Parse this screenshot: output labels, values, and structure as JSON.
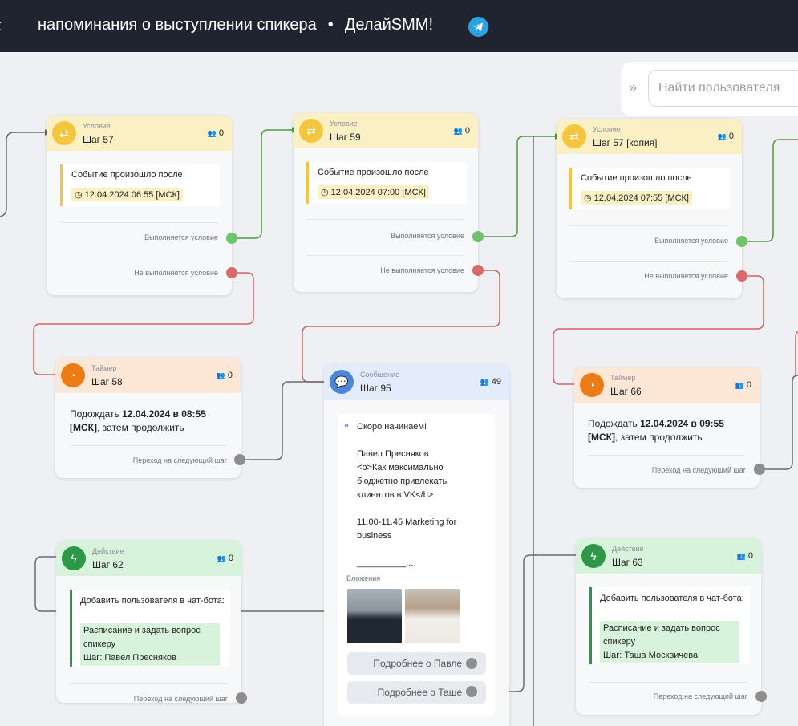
{
  "header": {
    "back_icon": "chevron-left-icon",
    "title": "напоминания о выступлении спикера",
    "separator": "•",
    "brand": "ДелайSMM!",
    "telegram_icon": "telegram-icon"
  },
  "search": {
    "placeholder": "Найти пользователя"
  },
  "colors": {
    "condition": "#fbf0c4",
    "timer": "#fde7d6",
    "message": "#e3ecfa",
    "action": "#d8f3dc",
    "header_bg": "#1f2430",
    "yes": "#6fc36a",
    "no": "#d86a6a"
  },
  "nodes": {
    "step57": {
      "type": "Условие",
      "name": "Шаг 57",
      "count": "0",
      "event": "Событие произошло после",
      "date": "12.04.2024 06:55 [МСК]",
      "out_yes": "Выполняется условие",
      "out_no": "Не выполняется условие"
    },
    "step59": {
      "type": "Условие",
      "name": "Шаг 59",
      "count": "0",
      "event": "Событие произошло после",
      "date": "12.04.2024 07:00 [МСК]",
      "out_yes": "Выполняется условие",
      "out_no": "Не выполняется условие"
    },
    "step57copy": {
      "type": "Условие",
      "name": "Шаг 57 [копия]",
      "count": "0",
      "event": "Событие произошло после",
      "date": "12.04.2024 07:55 [МСК]",
      "out_yes": "Выполняется условие",
      "out_no": "Не выполняется условие"
    },
    "step58": {
      "type": "Таймер",
      "name": "Шаг 58",
      "count": "0",
      "text_pre": "Подождать ",
      "text_bold": "12.04.2024 в 08:55 [МСК]",
      "text_post": ", затем продолжить",
      "out": "Переход на следующий шаг"
    },
    "step66": {
      "type": "Таймер",
      "name": "Шаг 66",
      "count": "0",
      "text_pre": "Подождать ",
      "text_bold": "12.04.2024 в 09:55 [МСК]",
      "text_post": ", затем продолжить",
      "out": "Переход на следующий шаг"
    },
    "step95": {
      "type": "Сообщение",
      "name": "Шаг 95",
      "count": "49",
      "message": "Скоро начинаем!\n\nПавел Пресняков\n<b>Как максимально бюджетно привлекать клиентов в VK</b>\n\n11.00-11.45 Marketing for business\n\n__________...",
      "attachments_label": "Вложения",
      "button1": "Подробнее о Павле",
      "button2": "Подробнее о Таше"
    },
    "step62": {
      "type": "Действие",
      "name": "Шаг 62",
      "count": "0",
      "action": "Добавить пользователя в чат-бота:",
      "target": "Расписание и задать вопрос спикеру",
      "target_step": "Шаг: Павел Пресняков",
      "out": "Переход на следующий шаг"
    },
    "step63": {
      "type": "Действие",
      "name": "Шаг 63",
      "count": "0",
      "action": "Добавить пользователя в чат-бота:",
      "target": "Расписание и задать вопрос спикеру",
      "target_step": "Шаг: Таша Москвичева",
      "out": "Переход на следующий шаг"
    }
  }
}
